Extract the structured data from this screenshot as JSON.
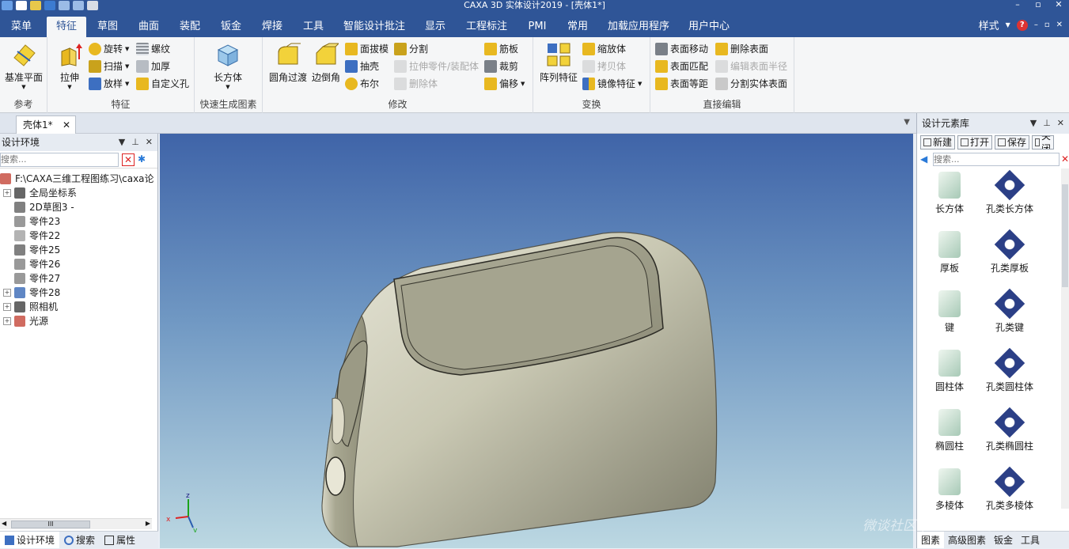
{
  "app_title": "CAXA 3D 实体设计2019 - [壳体1*]",
  "window_controls": [
    "–",
    "▫",
    "✕"
  ],
  "menu": {
    "tabs": [
      "菜单",
      "特征",
      "草图",
      "曲面",
      "装配",
      "钣金",
      "焊接",
      "工具",
      "智能设计批注",
      "显示",
      "工程标注",
      "PMI",
      "常用",
      "加载应用程序",
      "用户中心"
    ],
    "active": "特征",
    "style_label": "样式",
    "help": "?"
  },
  "ribbon": {
    "groups": {
      "reference": {
        "label": "参考",
        "datum": "基准平面"
      },
      "feature": {
        "label": "特征",
        "extrude": "拉伸",
        "revolve": "旋转",
        "sweep": "扫描",
        "loft": "放样",
        "thread": "螺纹",
        "thicken": "加厚",
        "custom_hole": "自定义孔"
      },
      "quick": {
        "label": "快速生成图素",
        "block": "长方体"
      },
      "modify": {
        "label": "修改",
        "fillet": "圆角过渡",
        "chamfer": "边倒角",
        "draft": "面拔模",
        "shell": "抽壳",
        "boolean": "布尔",
        "split": "分割",
        "stretch": "拉伸零件/装配体",
        "delete_body": "删除体",
        "rib": "筋板",
        "trim": "裁剪",
        "offset": "偏移"
      },
      "transform": {
        "label": "变换",
        "pattern": "阵列特征",
        "scale": "缩放体",
        "copy": "拷贝体",
        "mirror": "镜像特征"
      },
      "direct_edit": {
        "label": "直接编辑",
        "move_face": "表面移动",
        "match_face": "表面匹配",
        "offset_face": "表面等距",
        "delete_face": "删除表面",
        "edit_radius": "编辑表面半径",
        "split_solid_face": "分割实体表面"
      }
    }
  },
  "doc_tab": {
    "label": "壳体1*",
    "close": "✕"
  },
  "left_panel": {
    "title": "设计环境",
    "search_placeholder": "搜索...",
    "tree": [
      {
        "label": "F:\\CAXA三维工程图练习\\caxa论",
        "indent": 0,
        "exp": "",
        "icon": "#c0392b"
      },
      {
        "label": "全局坐标系",
        "indent": 1,
        "exp": "+",
        "icon": "#333333"
      },
      {
        "label": "2D草图3 -",
        "indent": 1,
        "exp": "",
        "icon": "#555555"
      },
      {
        "label": "零件23",
        "indent": 1,
        "exp": "",
        "icon": "#777777"
      },
      {
        "label": "零件22",
        "indent": 1,
        "exp": "",
        "icon": "#999999"
      },
      {
        "label": "零件25",
        "indent": 1,
        "exp": "",
        "icon": "#555555"
      },
      {
        "label": "零件26",
        "indent": 1,
        "exp": "",
        "icon": "#777777"
      },
      {
        "label": "零件27",
        "indent": 1,
        "exp": "",
        "icon": "#777777"
      },
      {
        "label": "零件28",
        "indent": 1,
        "exp": "+",
        "icon": "#2a5db0"
      },
      {
        "label": "照相机",
        "indent": 1,
        "exp": "+",
        "icon": "#333333"
      },
      {
        "label": "光源",
        "indent": 1,
        "exp": "+",
        "icon": "#c0392b"
      }
    ],
    "scroll_thumb": "III",
    "tabs": [
      "设计环境",
      "搜索",
      "属性"
    ]
  },
  "viewport": {
    "axes": {
      "x": "x",
      "y": "y",
      "z": "z"
    }
  },
  "right_panel": {
    "title": "设计元素库",
    "buttons": [
      "新建",
      "打开",
      "保存",
      "关闭"
    ],
    "search_placeholder": "搜索...",
    "items": [
      "长方体",
      "孔类长方体",
      "厚板",
      "孔类厚板",
      "键",
      "孔类键",
      "圆柱体",
      "孔类圆柱体",
      "椭圆柱",
      "孔类椭圆柱",
      "多棱体",
      "孔类多棱体"
    ],
    "tabs": [
      "图素",
      "高级图素",
      "钣金",
      "工具"
    ]
  },
  "watermark": "微谈社区 | CAXA数码大方",
  "colors": {
    "accent": "#2f5597",
    "ribbon_bg": "#f5f6f7",
    "model_body": "#c9c8b3"
  }
}
